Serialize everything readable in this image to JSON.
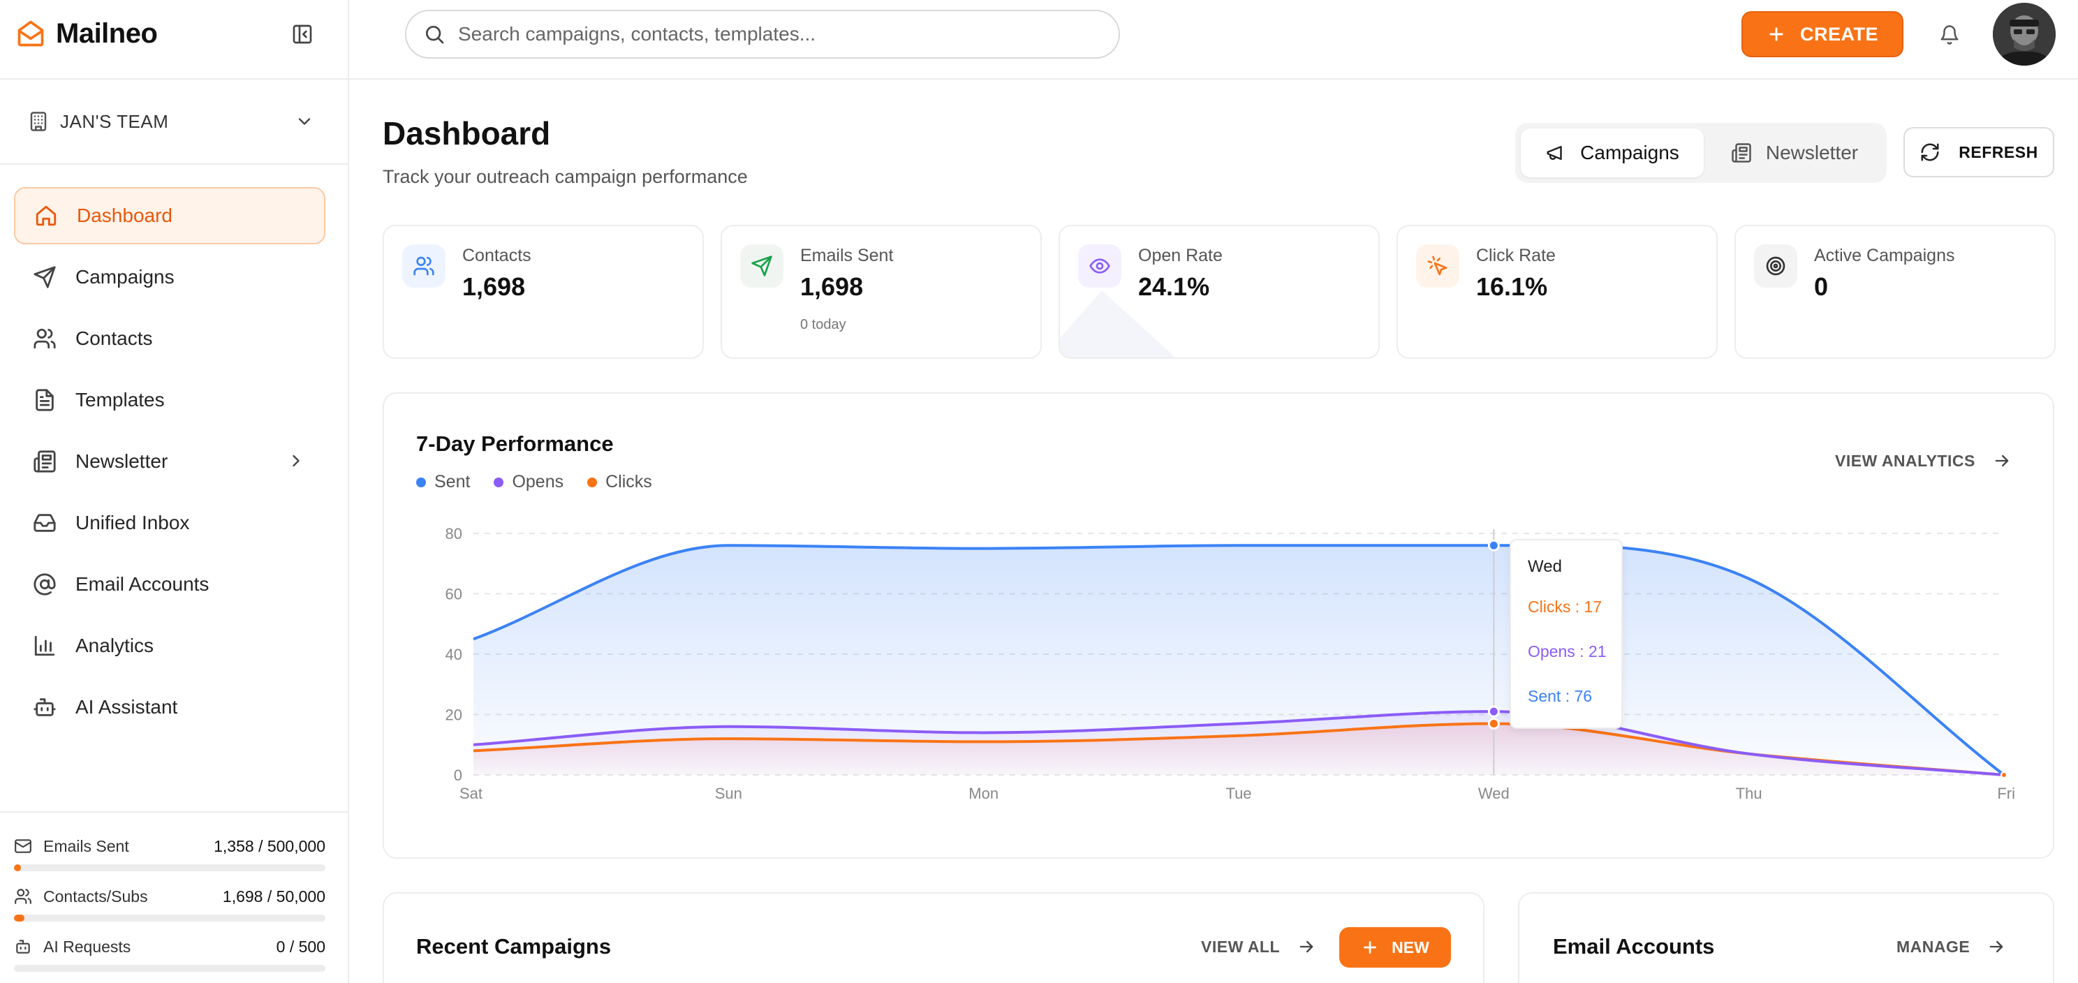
{
  "app": {
    "name": "Mailneo"
  },
  "team": {
    "name": "JAN'S TEAM"
  },
  "nav": [
    {
      "key": "dashboard",
      "label": "Dashboard",
      "icon": "home-icon",
      "active": true
    },
    {
      "key": "campaigns",
      "label": "Campaigns",
      "icon": "send-icon"
    },
    {
      "key": "contacts",
      "label": "Contacts",
      "icon": "users-icon"
    },
    {
      "key": "templates",
      "label": "Templates",
      "icon": "file-text-icon"
    },
    {
      "key": "newsletter",
      "label": "Newsletter",
      "icon": "newspaper-icon",
      "has_submenu": true
    },
    {
      "key": "unified-inbox",
      "label": "Unified Inbox",
      "icon": "inbox-icon"
    },
    {
      "key": "email-accounts",
      "label": "Email Accounts",
      "icon": "at-sign-icon"
    },
    {
      "key": "analytics",
      "label": "Analytics",
      "icon": "bar-chart-icon"
    },
    {
      "key": "ai-assistant",
      "label": "AI Assistant",
      "icon": "bot-icon"
    }
  ],
  "usage": [
    {
      "label": "Emails Sent",
      "value": "1,358 / 500,000",
      "fraction": 0.0027,
      "icon": "mail-icon"
    },
    {
      "label": "Contacts/Subs",
      "value": "1,698 / 50,000",
      "fraction": 0.034,
      "icon": "users-icon"
    },
    {
      "label": "AI Requests",
      "value": "0 / 500",
      "fraction": 0,
      "icon": "bot-icon"
    }
  ],
  "search": {
    "placeholder": "Search campaigns, contacts, templates..."
  },
  "topbar": {
    "create_label": "CREATE"
  },
  "header": {
    "title": "Dashboard",
    "subtitle": "Track your outreach campaign performance",
    "tabs": [
      {
        "label": "Campaigns",
        "active": true,
        "icon": "megaphone-icon"
      },
      {
        "label": "Newsletter",
        "active": false,
        "icon": "newspaper-icon"
      }
    ],
    "refresh_label": "REFRESH"
  },
  "stats": [
    {
      "label": "Contacts",
      "value": "1,698",
      "note": "",
      "icon": "users-icon",
      "color": "#3b82f6",
      "bg": "#eef4ff"
    },
    {
      "label": "Emails Sent",
      "value": "1,698",
      "note": "0 today",
      "icon": "send-icon",
      "color": "#16a34a",
      "bg": "#f1f5f1"
    },
    {
      "label": "Open Rate",
      "value": "24.1%",
      "note": "",
      "icon": "eye-icon",
      "color": "#8b5cf6",
      "bg": "#f4f0ff"
    },
    {
      "label": "Click Rate",
      "value": "16.1%",
      "note": "",
      "icon": "cursor-click-icon",
      "color": "#f97316",
      "bg": "#fff3ea"
    },
    {
      "label": "Active Campaigns",
      "value": "0",
      "note": "",
      "icon": "target-icon",
      "color": "#333333",
      "bg": "#f3f3f3"
    }
  ],
  "performance": {
    "title": "7-Day Performance",
    "view_label": "VIEW ANALYTICS",
    "tooltip": {
      "day": "Wed",
      "clicks_label": "Clicks : 17",
      "opens_label": "Opens : 21",
      "sent_label": "Sent : 76"
    }
  },
  "chart_data": {
    "type": "area",
    "title": "7-Day Performance",
    "x": [
      "Sat",
      "Sun",
      "Mon",
      "Tue",
      "Wed",
      "Thu",
      "Fri"
    ],
    "ylim": [
      0,
      80
    ],
    "yticks": [
      0,
      20,
      40,
      60,
      80
    ],
    "grid": true,
    "legend_position": "top-left",
    "series": [
      {
        "name": "Sent",
        "color": "#3b82f6",
        "values": [
          45,
          76,
          75,
          76,
          76,
          65,
          0
        ]
      },
      {
        "name": "Opens",
        "color": "#8b5cf6",
        "values": [
          10,
          16,
          14,
          17,
          21,
          7,
          0
        ]
      },
      {
        "name": "Clicks",
        "color": "#f97316",
        "values": [
          8,
          12,
          11,
          13,
          17,
          7,
          0
        ]
      }
    ],
    "highlight_index": 4
  },
  "recent": {
    "title": "Recent Campaigns",
    "view_all_label": "VIEW ALL",
    "new_label": "NEW"
  },
  "accounts": {
    "title": "Email Accounts",
    "manage_label": "MANAGE"
  }
}
